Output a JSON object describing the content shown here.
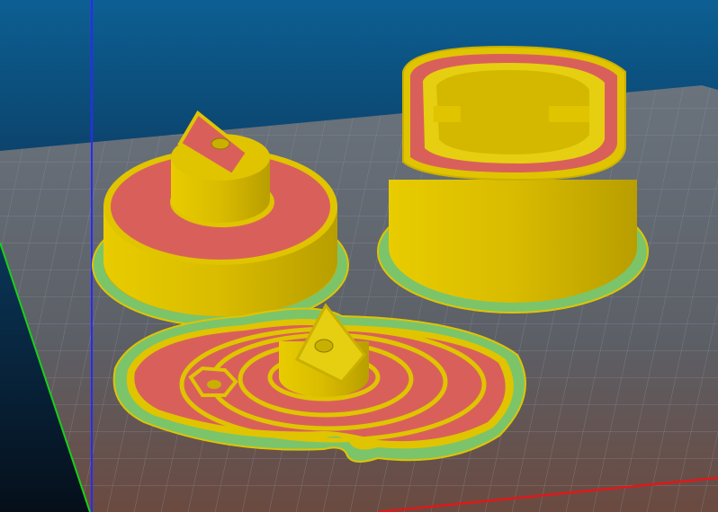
{
  "viewport": {
    "colors": {
      "background_top": "#0d5f93",
      "background_bottom": "#061421",
      "plate": "#5f6670",
      "perimeter": "#e0c400",
      "infill": "#d9605a",
      "skirt": "#7cc46a",
      "axis_x": "#e01010",
      "axis_y": "#10d010",
      "axis_z": "#2020ff"
    }
  }
}
